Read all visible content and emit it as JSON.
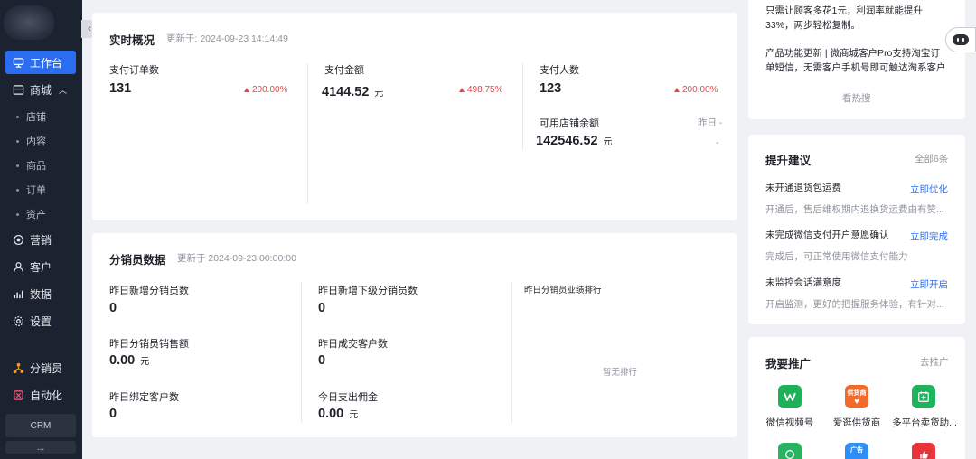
{
  "sidebar": {
    "items": [
      {
        "label": "工作台",
        "icon": "desk-icon"
      },
      {
        "label": "商城",
        "icon": "shop-icon"
      },
      {
        "label": "营销",
        "icon": "marketing-icon"
      },
      {
        "label": "客户",
        "icon": "user-icon"
      },
      {
        "label": "数据",
        "icon": "chart-icon"
      },
      {
        "label": "设置",
        "icon": "gear-icon"
      },
      {
        "label": "分销员",
        "icon": "distributor-icon"
      },
      {
        "label": "自动化",
        "icon": "automation-icon"
      }
    ],
    "shop_subitems": [
      "店铺",
      "内容",
      "商品",
      "订单",
      "资产"
    ],
    "crm_label": "CRM",
    "more_label": "...",
    "accent": "#2a6df0"
  },
  "realtime": {
    "title": "实时概况",
    "updated": "更新于: 2024-09-23 14:14:49",
    "metrics": [
      {
        "label": "支付订单数",
        "value": "131",
        "unit": "",
        "change": "200.00%"
      },
      {
        "label": "支付金额",
        "value": "4144.52",
        "unit": "元",
        "change": "498.75%"
      },
      {
        "label": "支付人数",
        "value": "123",
        "unit": "",
        "change": "200.00%"
      }
    ],
    "balance": {
      "label": "可用店铺余额",
      "value": "142546.52",
      "unit": "元",
      "yesterday_label": "昨日 -",
      "dash": "-"
    }
  },
  "distributor": {
    "title": "分销员数据",
    "updated": "更新于 2024-09-23 00:00:00",
    "metrics": [
      {
        "label": "昨日新增分销员数",
        "value": "0",
        "unit": ""
      },
      {
        "label": "昨日新增下级分销员数",
        "value": "0",
        "unit": ""
      },
      {
        "label": "昨日分销员销售额",
        "value": "0.00",
        "unit": "元"
      },
      {
        "label": "昨日成交客户数",
        "value": "0",
        "unit": ""
      },
      {
        "label": "昨日绑定客户数",
        "value": "0",
        "unit": ""
      },
      {
        "label": "今日支出佣金",
        "value": "0.00",
        "unit": "元"
      }
    ],
    "ranking_title": "昨日分销员业绩排行",
    "ranking_empty": "暂无排行"
  },
  "news": {
    "line1": "只需让顾客多花1元，利润率就能提升",
    "line2": "33%，两步轻松复制。",
    "line3": "产品功能更新 | 微商城客户Pro支持淘宝订",
    "line4": "单短信，无需客户手机号即可触达淘系客户",
    "hot_label": "看热搜"
  },
  "suggestions": {
    "title": "提升建议",
    "all_label": "全部6条",
    "items": [
      {
        "title": "未开通退货包运费",
        "action": "立即优化",
        "desc": "开通后，售后维权期内退换货运费由有赞..."
      },
      {
        "title": "未完成微信支付开户意愿确认",
        "action": "立即完成",
        "desc": "完成后，可正常使用微信支付能力"
      },
      {
        "title": "未监控会话满意度",
        "action": "立即开启",
        "desc": "开启监测，更好的把握服务体验，有针对..."
      }
    ]
  },
  "promotion": {
    "title": "我要推广",
    "action_label": "去推广",
    "items": [
      {
        "label": "微信视频号",
        "icon": "wechat-channels-icon",
        "color": "#1fb15a"
      },
      {
        "label": "爱逛供货商",
        "icon": "supplier-icon",
        "badge": "供货商",
        "color": "#f26b2c"
      },
      {
        "label": "多平台卖货助...",
        "icon": "multi-platform-icon",
        "color": "#20b35e"
      }
    ],
    "row2_badge": "广告",
    "row2_colors": [
      "#27b361",
      "#2e8ef5",
      "#e8333a"
    ]
  }
}
